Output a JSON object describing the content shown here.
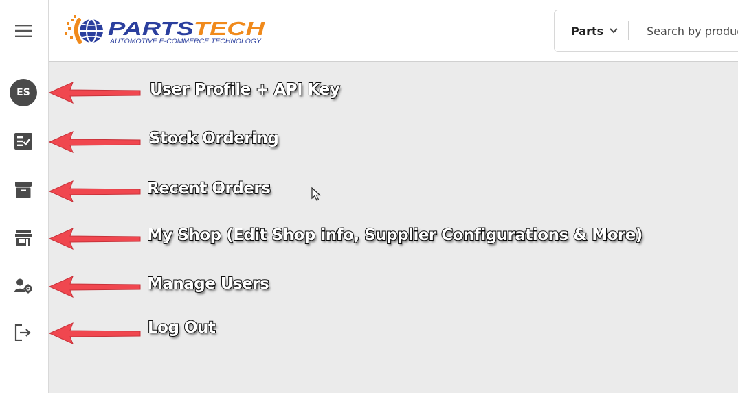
{
  "sidebar": {
    "menu_icon": "hamburger-menu-icon",
    "avatar_initials": "ES",
    "items": [
      {
        "icon": "stock-ordering-icon"
      },
      {
        "icon": "archive-box-icon"
      },
      {
        "icon": "storefront-icon"
      },
      {
        "icon": "user-settings-icon"
      },
      {
        "icon": "logout-icon"
      }
    ]
  },
  "header": {
    "logo_text": "PARTSTECH",
    "logo_tagline": "AUTOMOTIVE E-COMMERCE TECHNOLOGY",
    "search_category": "Parts",
    "search_placeholder": "Search by product"
  },
  "annotations": [
    {
      "label": "User Profile + API Key"
    },
    {
      "label": "Stock Ordering"
    },
    {
      "label": "Recent Orders"
    },
    {
      "label": "My Shop (Edit Shop info, Supplier Configurations & More)"
    },
    {
      "label": "Manage Users"
    },
    {
      "label": "Log Out"
    }
  ],
  "colors": {
    "brand_blue": "#2b3f9e",
    "brand_orange": "#f08a1c",
    "arrow_red": "#f0474f",
    "main_bg": "#ebebeb",
    "icon_gray": "#4a4a4a"
  }
}
